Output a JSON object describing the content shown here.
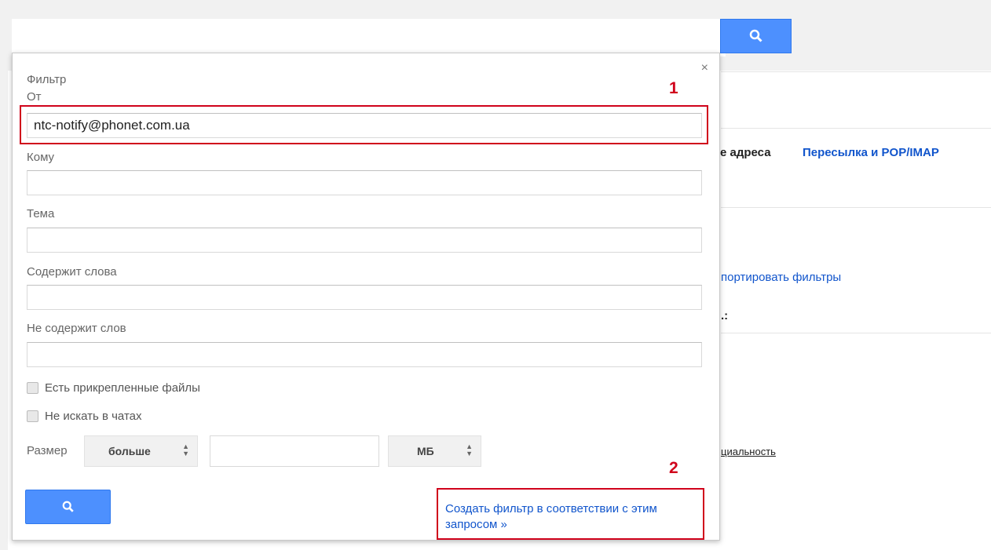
{
  "search": {
    "query": ""
  },
  "background": {
    "tab_addresses": "е адреса",
    "tab_forwarding": "Пересылка и POP/IMAP",
    "link_export_filters": "портировать фильтры",
    "text_colon": ".:",
    "link_privacy": "циальность"
  },
  "filter_dialog": {
    "title": "Фильтр",
    "close_label": "×",
    "from": {
      "label": "От",
      "value": "ntc-notify@phonet.com.ua"
    },
    "to": {
      "label": "Кому",
      "value": ""
    },
    "subject": {
      "label": "Тема",
      "value": ""
    },
    "has_words": {
      "label": "Содержит слова",
      "value": ""
    },
    "doesnt_have": {
      "label": "Не содержит слов",
      "value": ""
    },
    "has_attachment": {
      "label": "Есть прикрепленные файлы",
      "checked": false
    },
    "exclude_chats": {
      "label": "Не искать в чатах",
      "checked": false
    },
    "size": {
      "label": "Размер",
      "operator": "больше",
      "value": "",
      "unit": "МБ"
    },
    "create_filter_link": "Создать фильтр в соответствии с этим запросом »"
  },
  "annotations": {
    "marker_1": "1",
    "marker_2": "2",
    "color": "#d0021b"
  },
  "colors": {
    "accent": "#4d90fe",
    "link": "#1155cc"
  }
}
